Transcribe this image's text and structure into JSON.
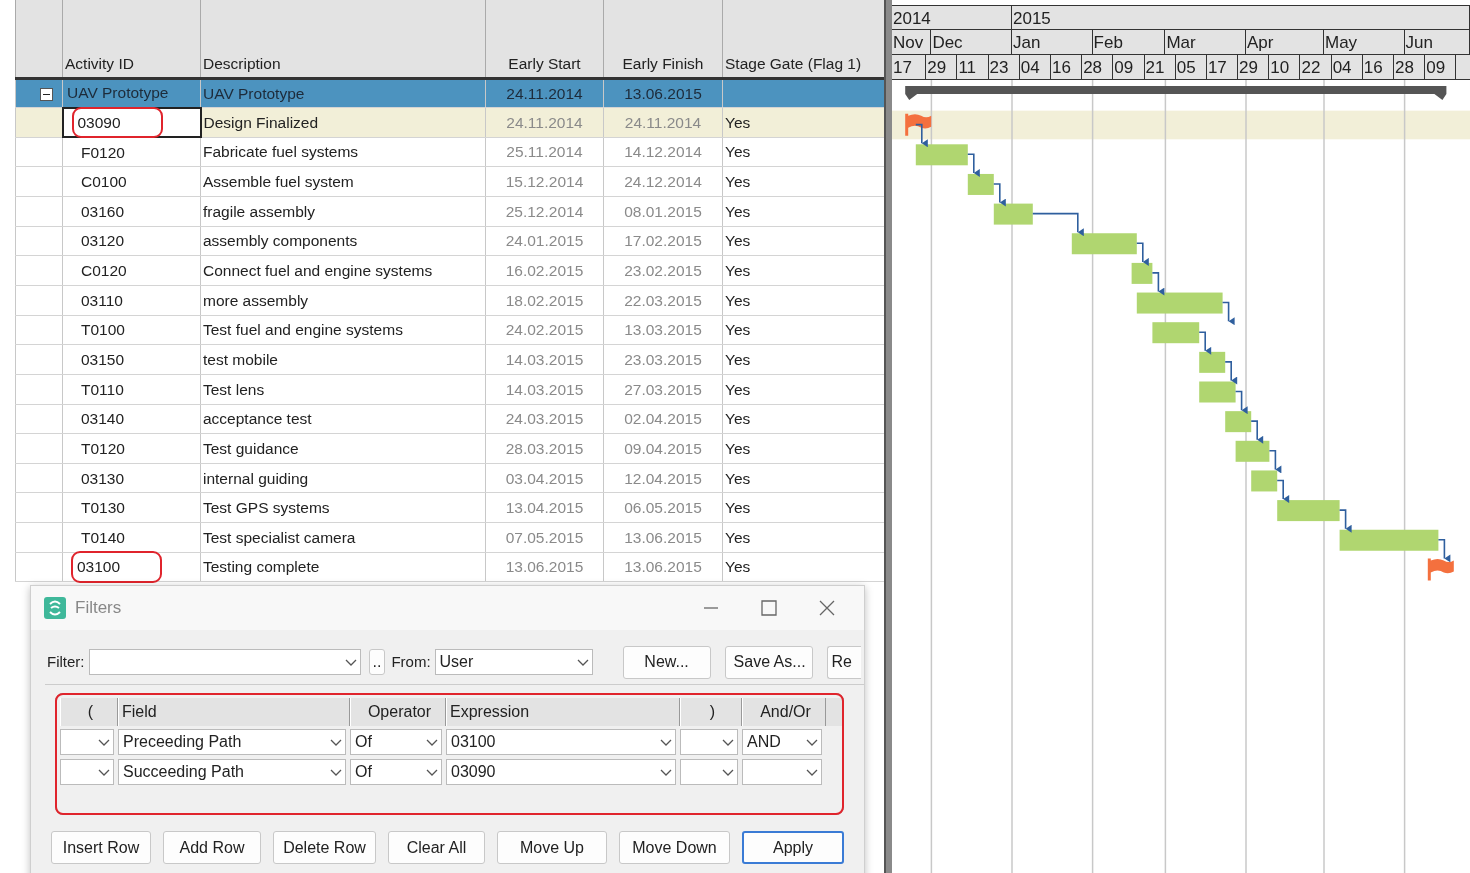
{
  "table": {
    "columns": [
      "Activity ID",
      "Description",
      "Early Start",
      "Early Finish",
      "Stage Gate (Flag 1)"
    ],
    "rows": [
      {
        "activity_id": "UAV Prototype",
        "description": "UAV Prototype",
        "early_start": "24.11.2014",
        "early_finish": "13.06.2015",
        "kind": "summary",
        "expanded": true,
        "selected": false,
        "highlighted": false,
        "children": [
          {
            "activity_id": "03090",
            "description": "Design Finalized",
            "early_start": "24.11.2014",
            "early_finish": "24.11.2014",
            "stage_gate": "Yes",
            "kind": "milestone",
            "selected": true,
            "highlighted": true
          },
          {
            "activity_id": "F0120",
            "description": "Fabricate fuel systems",
            "early_start": "25.11.2014",
            "early_finish": "14.12.2014",
            "stage_gate": "Yes",
            "kind": "task",
            "selected": false,
            "highlighted": false
          },
          {
            "activity_id": "C0100",
            "description": "Assemble fuel system",
            "early_start": "15.12.2014",
            "early_finish": "24.12.2014",
            "stage_gate": "Yes",
            "kind": "task",
            "selected": false,
            "highlighted": false
          },
          {
            "activity_id": "03160",
            "description": "fragile assembly",
            "early_start": "25.12.2014",
            "early_finish": "08.01.2015",
            "stage_gate": "Yes",
            "kind": "task",
            "selected": false,
            "highlighted": false
          },
          {
            "activity_id": "03120",
            "description": "assembly components",
            "early_start": "24.01.2015",
            "early_finish": "17.02.2015",
            "stage_gate": "Yes",
            "kind": "task",
            "selected": false,
            "highlighted": false
          },
          {
            "activity_id": "C0120",
            "description": "Connect fuel and engine systems",
            "early_start": "16.02.2015",
            "early_finish": "23.02.2015",
            "stage_gate": "Yes",
            "kind": "task",
            "selected": false,
            "highlighted": false
          },
          {
            "activity_id": "03110",
            "description": "more assembly",
            "early_start": "18.02.2015",
            "early_finish": "22.03.2015",
            "stage_gate": "Yes",
            "kind": "task",
            "selected": false,
            "highlighted": false
          },
          {
            "activity_id": "T0100",
            "description": "Test fuel and engine systems",
            "early_start": "24.02.2015",
            "early_finish": "13.03.2015",
            "stage_gate": "Yes",
            "kind": "task",
            "selected": false,
            "highlighted": false
          },
          {
            "activity_id": "03150",
            "description": "test mobile",
            "early_start": "14.03.2015",
            "early_finish": "23.03.2015",
            "stage_gate": "Yes",
            "kind": "task",
            "selected": false,
            "highlighted": false
          },
          {
            "activity_id": "T0110",
            "description": "Test lens",
            "early_start": "14.03.2015",
            "early_finish": "27.03.2015",
            "stage_gate": "Yes",
            "kind": "task",
            "selected": false,
            "highlighted": false
          },
          {
            "activity_id": "03140",
            "description": "acceptance test",
            "early_start": "24.03.2015",
            "early_finish": "02.04.2015",
            "stage_gate": "Yes",
            "kind": "task",
            "selected": false,
            "highlighted": false
          },
          {
            "activity_id": "T0120",
            "description": "Test guidance",
            "early_start": "28.03.2015",
            "early_finish": "09.04.2015",
            "stage_gate": "Yes",
            "kind": "task",
            "selected": false,
            "highlighted": false
          },
          {
            "activity_id": "03130",
            "description": "internal guiding",
            "early_start": "03.04.2015",
            "early_finish": "12.04.2015",
            "stage_gate": "Yes",
            "kind": "task",
            "selected": false,
            "highlighted": false
          },
          {
            "activity_id": "T0130",
            "description": "Test GPS systems",
            "early_start": "13.04.2015",
            "early_finish": "06.05.2015",
            "stage_gate": "Yes",
            "kind": "task",
            "selected": false,
            "highlighted": false
          },
          {
            "activity_id": "T0140",
            "description": "Test specialist camera",
            "early_start": "07.05.2015",
            "early_finish": "13.06.2015",
            "stage_gate": "Yes",
            "kind": "task",
            "selected": false,
            "highlighted": false
          },
          {
            "activity_id": "03100",
            "description": "Testing complete",
            "early_start": "13.06.2015",
            "early_finish": "13.06.2015",
            "stage_gate": "Yes",
            "kind": "milestone",
            "selected": false,
            "highlighted": true
          }
        ]
      }
    ]
  },
  "gantt": {
    "years": [
      "2014",
      "2015"
    ],
    "months": [
      "Nov",
      "Dec",
      "Jan",
      "Feb",
      "Mar",
      "Apr",
      "May",
      "Jun"
    ],
    "days": [
      "17",
      "29",
      "11",
      "23",
      "04",
      "16",
      "28",
      "09",
      "21",
      "05",
      "17",
      "29",
      "10",
      "22",
      "04",
      "16",
      "28",
      "09"
    ]
  },
  "filters_dialog": {
    "title": "Filters",
    "filter_label": "Filter:",
    "more_button": "..",
    "from_label": "From:",
    "from_value": "User",
    "top_buttons": [
      "New...",
      "Save As...",
      "Re"
    ],
    "grid": {
      "highlighted": true,
      "columns": [
        "(",
        "Field",
        "Operator",
        "Expression",
        ")",
        "And/Or"
      ],
      "rows": [
        {
          "field": "Preceeding Path",
          "operator": "Of",
          "expression": "03100",
          "and_or": "AND"
        },
        {
          "field": "Succeeding Path",
          "operator": "Of",
          "expression": "03090"
        }
      ]
    },
    "buttons": [
      {
        "label": "Insert Row",
        "default": false
      },
      {
        "label": "Add Row",
        "default": false
      },
      {
        "label": "Delete Row",
        "default": false
      },
      {
        "label": "Clear All",
        "default": false
      },
      {
        "label": "Move Up",
        "default": false
      },
      {
        "label": "Move Down",
        "default": false
      },
      {
        "label": "Apply",
        "default": true
      }
    ]
  }
}
